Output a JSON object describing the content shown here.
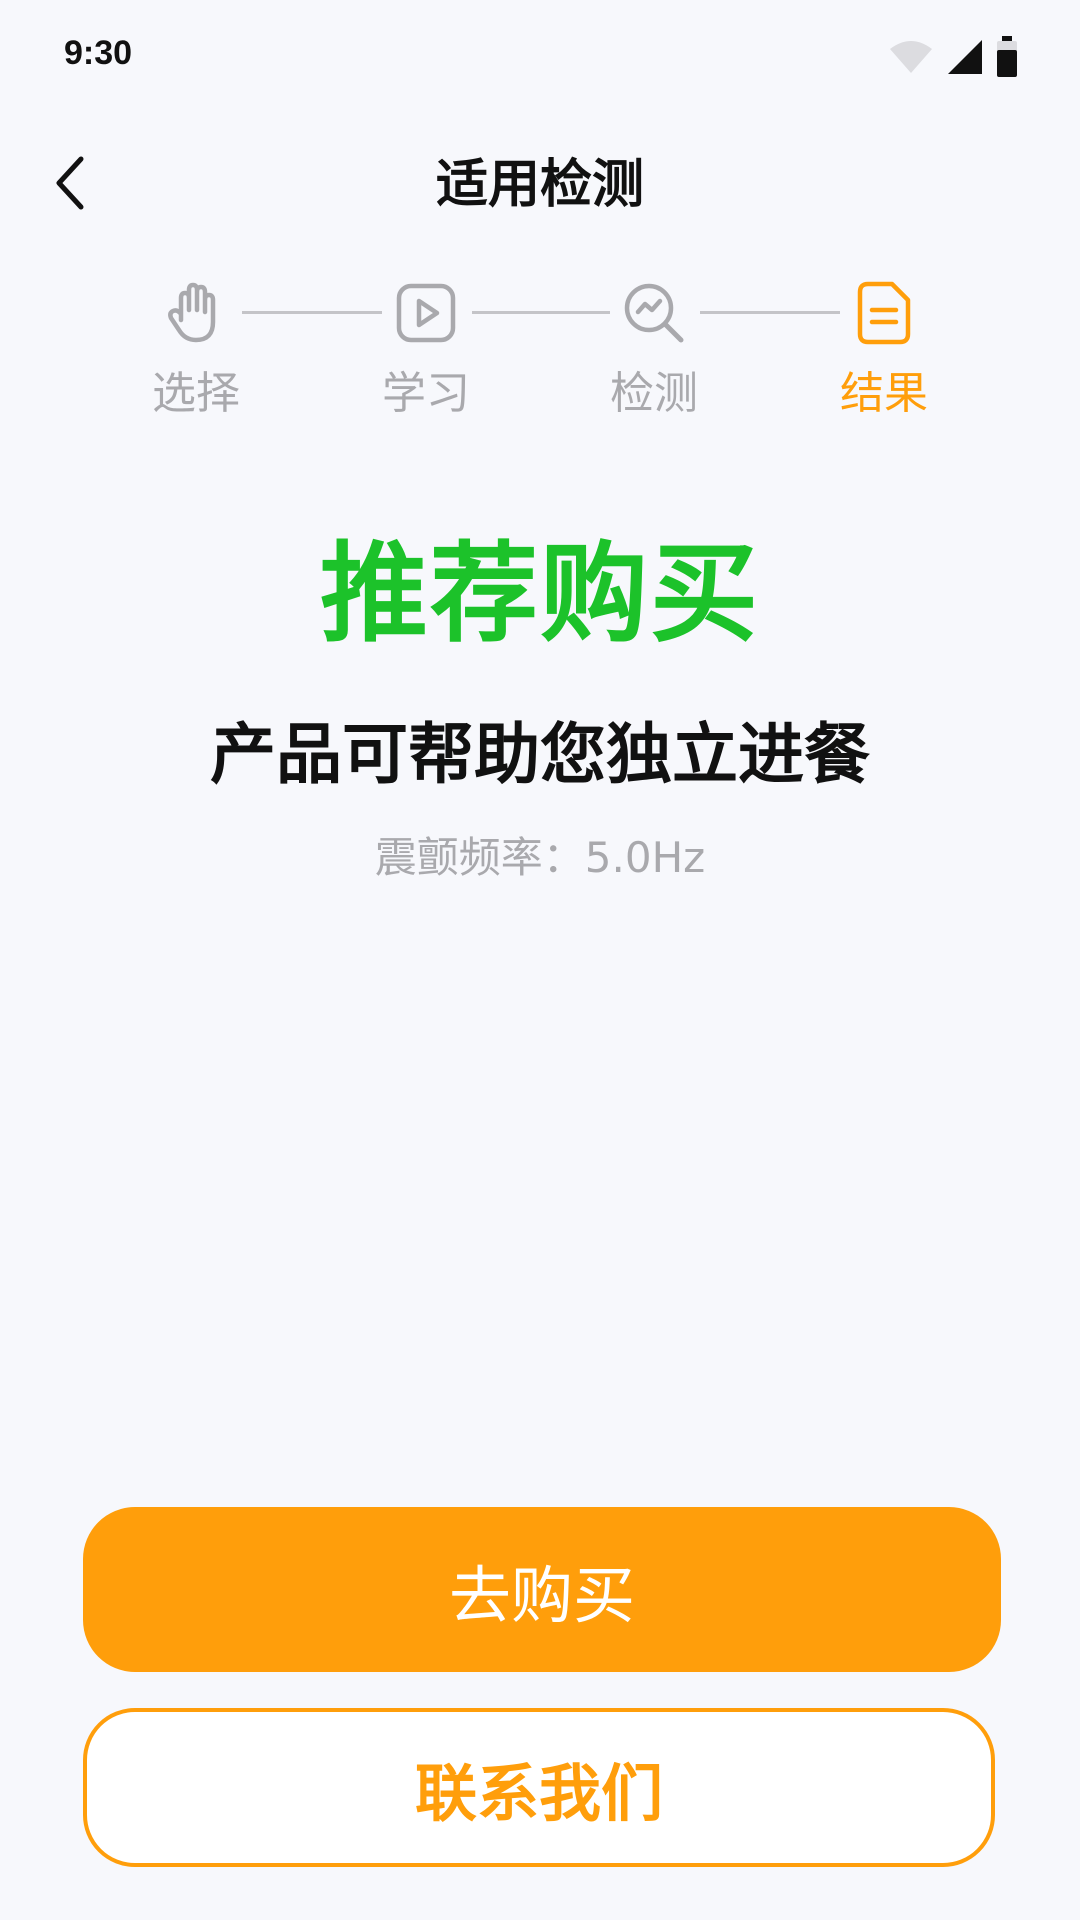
{
  "status_bar": {
    "time": "9:30",
    "icons": [
      "wifi-icon",
      "cellular-signal-icon",
      "battery-icon"
    ]
  },
  "header": {
    "title": "适用检测",
    "back_icon": "chevron-left-icon"
  },
  "stepper": {
    "steps": [
      {
        "label": "选择",
        "icon": "hand-icon",
        "active": false
      },
      {
        "label": "学习",
        "icon": "play-icon",
        "active": false
      },
      {
        "label": "检测",
        "icon": "search-chart-icon",
        "active": false
      },
      {
        "label": "结果",
        "icon": "document-icon",
        "active": true
      }
    ]
  },
  "result": {
    "title": "推荐购买",
    "subtitle": "产品可帮助您独立进餐",
    "detail": "震颤频率：5.0Hz"
  },
  "actions": {
    "buy_label": "去购买",
    "contact_label": "联系我们"
  },
  "colors": {
    "accent": "#ff9e0b",
    "success": "#1cc22a",
    "inactive": "#a9a9ad",
    "background": "#f7f8fc"
  }
}
